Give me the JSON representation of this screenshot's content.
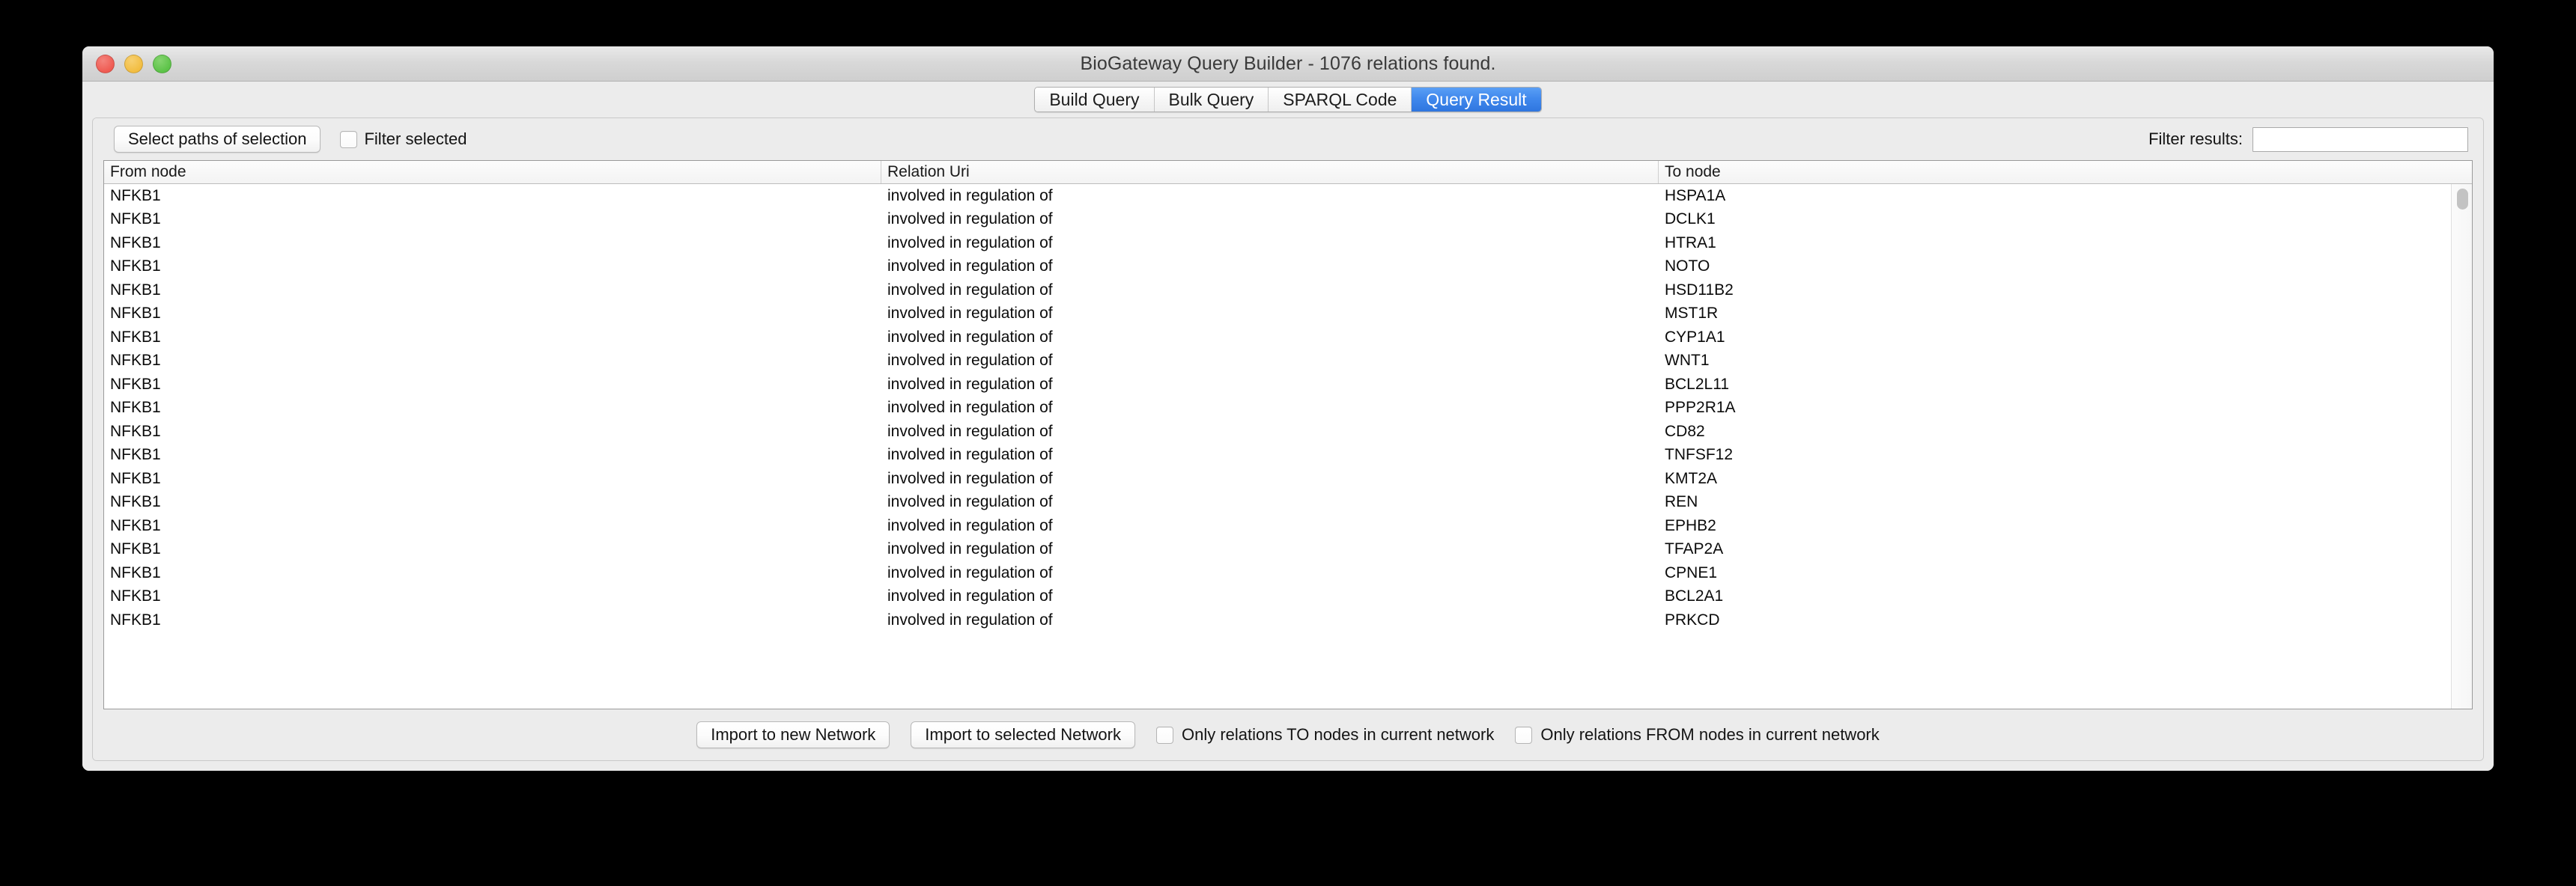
{
  "window": {
    "title": "BioGateway Query Builder - 1076 relations found.",
    "controls": [
      {
        "name": "close",
        "color": "#ef5b52"
      },
      {
        "name": "minimize",
        "color": "#f2bd41"
      },
      {
        "name": "maximize",
        "color": "#5cc348"
      }
    ]
  },
  "tabs": [
    {
      "label": "Build Query",
      "selected": false
    },
    {
      "label": "Bulk Query",
      "selected": false
    },
    {
      "label": "SPARQL Code",
      "selected": false
    },
    {
      "label": "Query Result",
      "selected": true
    }
  ],
  "accent_color": "#3f87ec",
  "toolbar": {
    "select_paths_label": "Select paths of selection",
    "filter_selected_label": "Filter selected",
    "filter_selected_checked": false,
    "filter_results_label": "Filter results:",
    "filter_results_value": "",
    "filter_results_placeholder": ""
  },
  "table": {
    "columns": [
      "From node",
      "Relation Uri",
      "To node"
    ],
    "rows": [
      [
        "NFKB1",
        "involved in regulation of",
        "HSPA1A"
      ],
      [
        "NFKB1",
        "involved in regulation of",
        "DCLK1"
      ],
      [
        "NFKB1",
        "involved in regulation of",
        "HTRA1"
      ],
      [
        "NFKB1",
        "involved in regulation of",
        "NOTO"
      ],
      [
        "NFKB1",
        "involved in regulation of",
        "HSD11B2"
      ],
      [
        "NFKB1",
        "involved in regulation of",
        "MST1R"
      ],
      [
        "NFKB1",
        "involved in regulation of",
        "CYP1A1"
      ],
      [
        "NFKB1",
        "involved in regulation of",
        "WNT1"
      ],
      [
        "NFKB1",
        "involved in regulation of",
        "BCL2L11"
      ],
      [
        "NFKB1",
        "involved in regulation of",
        "PPP2R1A"
      ],
      [
        "NFKB1",
        "involved in regulation of",
        "CD82"
      ],
      [
        "NFKB1",
        "involved in regulation of",
        "TNFSF12"
      ],
      [
        "NFKB1",
        "involved in regulation of",
        "KMT2A"
      ],
      [
        "NFKB1",
        "involved in regulation of",
        "REN"
      ],
      [
        "NFKB1",
        "involved in regulation of",
        "EPHB2"
      ],
      [
        "NFKB1",
        "involved in regulation of",
        "TFAP2A"
      ],
      [
        "NFKB1",
        "involved in regulation of",
        "CPNE1"
      ],
      [
        "NFKB1",
        "involved in regulation of",
        "BCL2A1"
      ],
      [
        "NFKB1",
        "involved in regulation of",
        "PRKCD"
      ]
    ]
  },
  "footer": {
    "import_new_label": "Import to new Network",
    "import_selected_label": "Import to selected Network",
    "only_to_label": "Only relations TO nodes in current network",
    "only_to_checked": false,
    "only_from_label": "Only relations FROM nodes in current network",
    "only_from_checked": false
  }
}
